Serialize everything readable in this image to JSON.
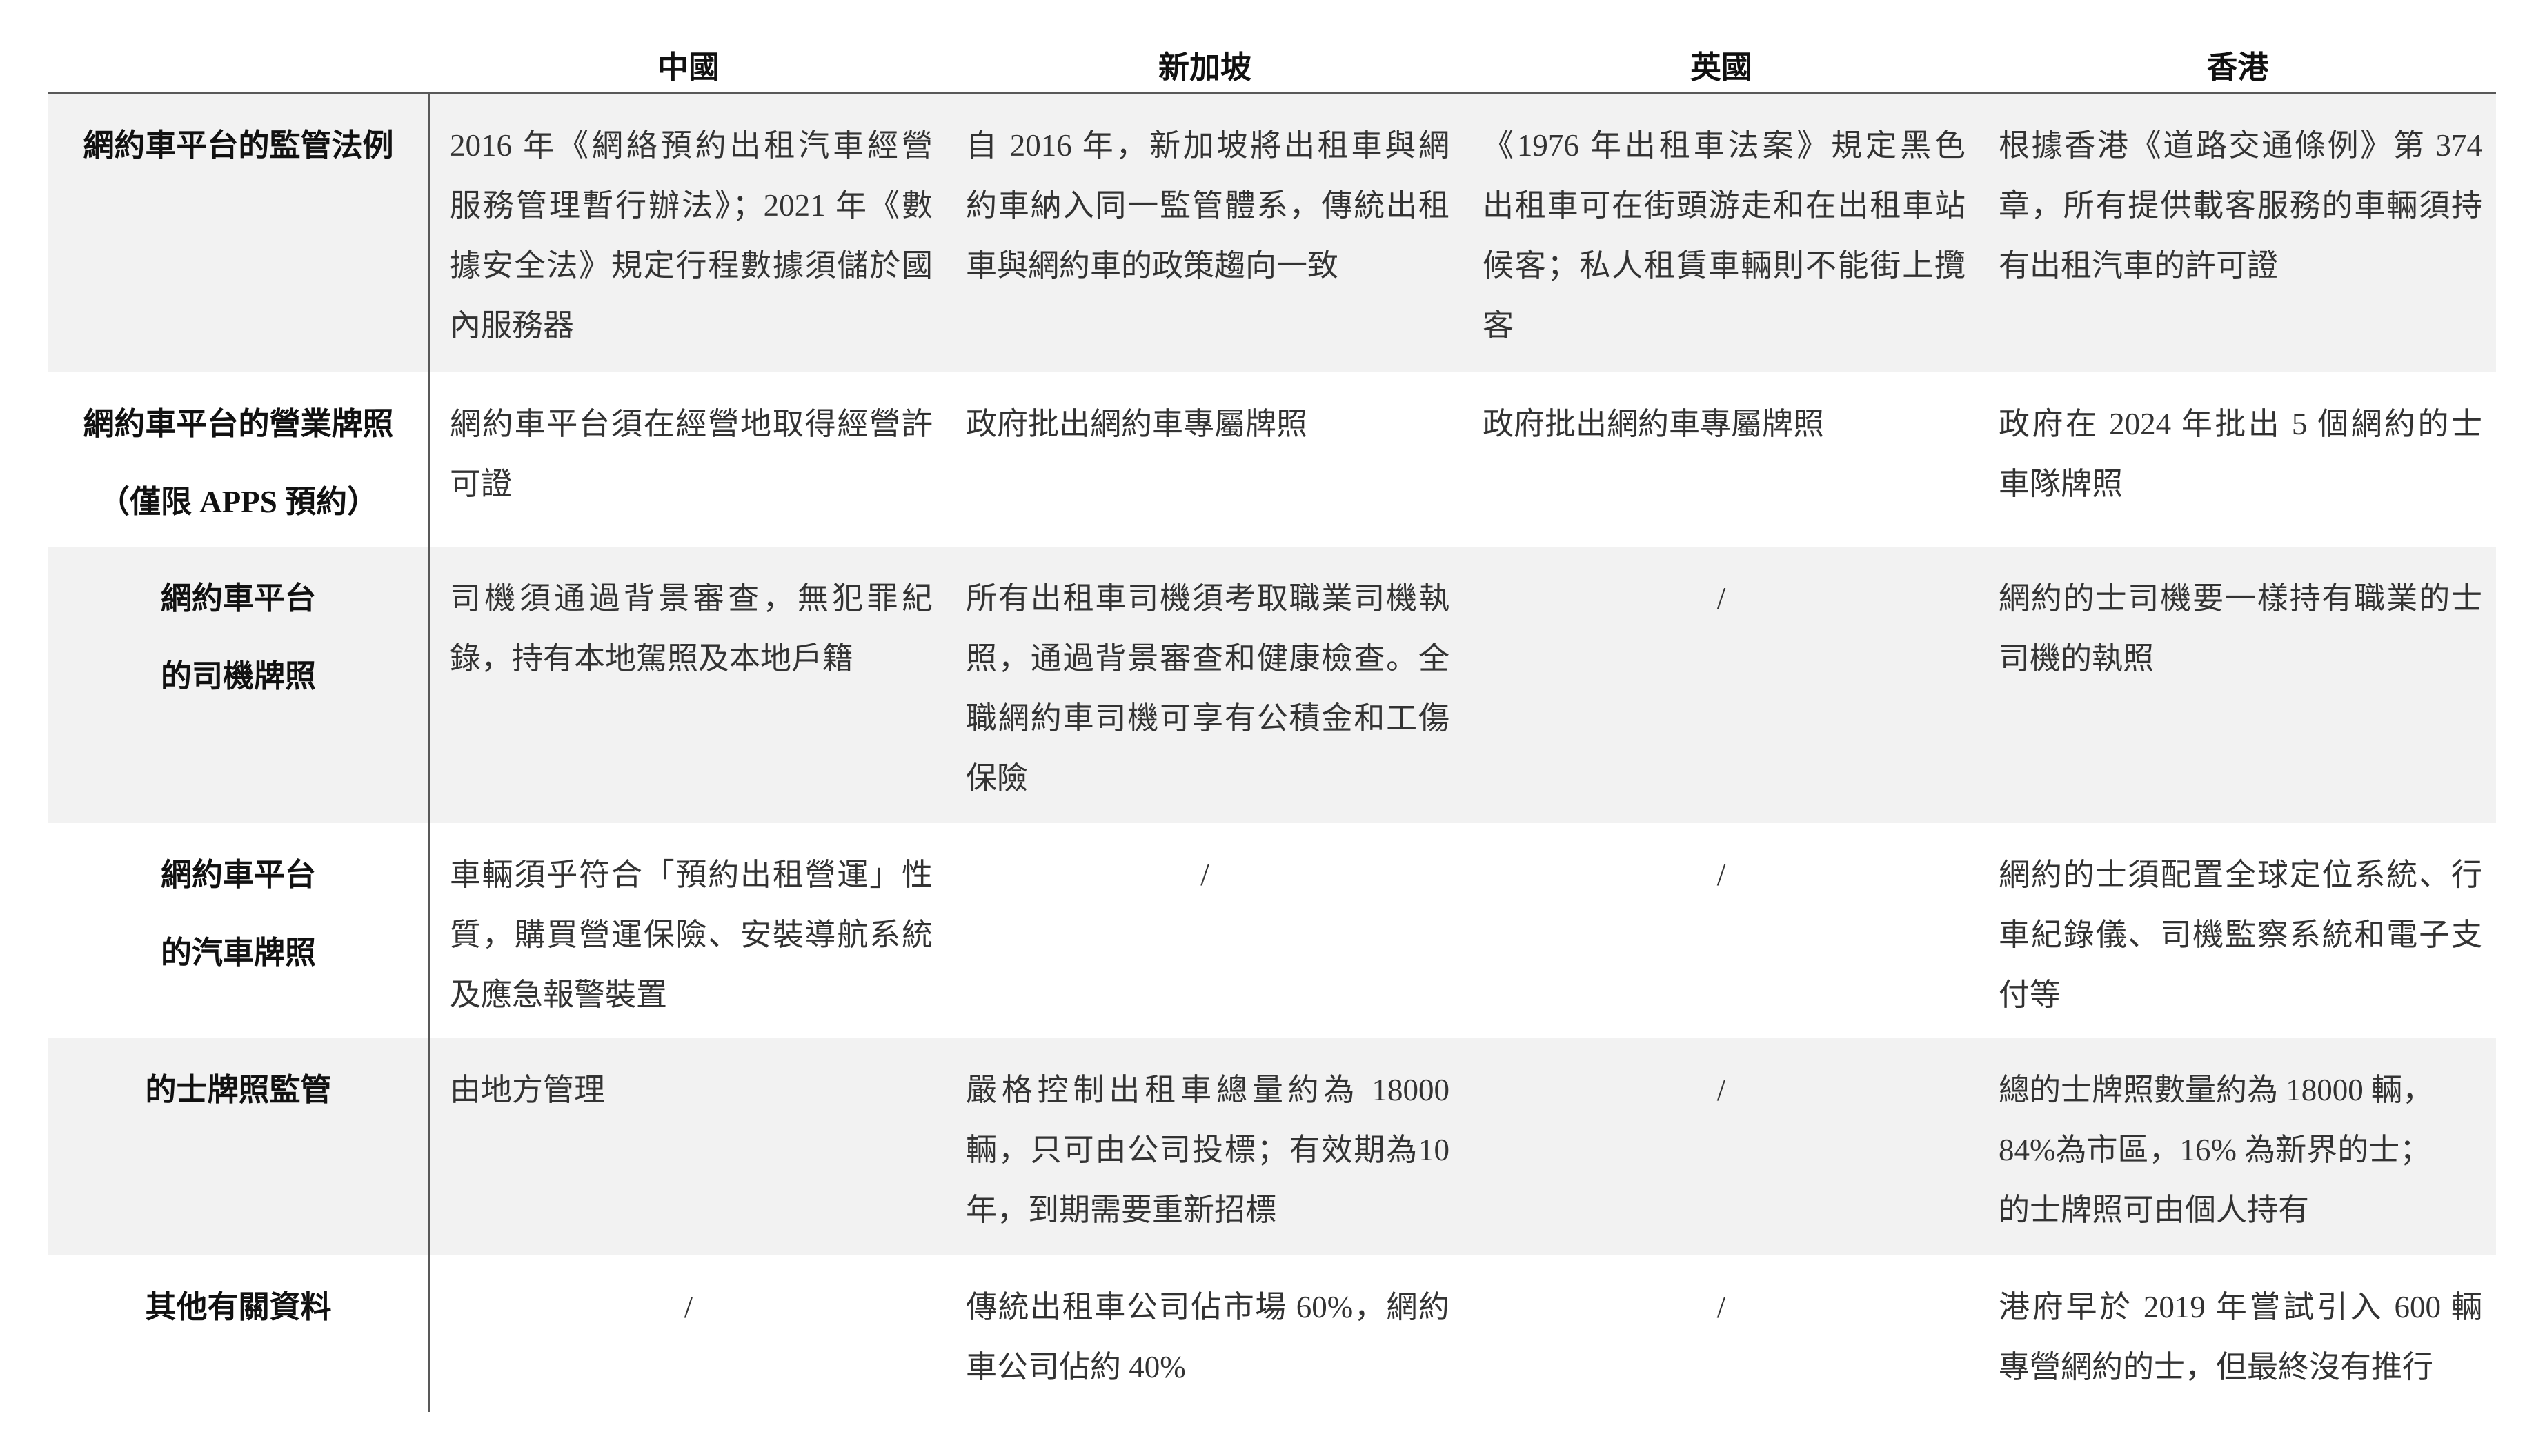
{
  "theme": {
    "stripe_color": "#f2f2f2",
    "rule_color": "#595959",
    "text_color": "#333333",
    "heading_color": "#111111"
  },
  "table": {
    "columns": [
      "中國",
      "新加坡",
      "英國",
      "香港"
    ],
    "rows": [
      {
        "label": [
          "網約車平台的監管法例"
        ],
        "cells": [
          [
            "2016 年《網絡預約出租汽車經營",
            "服務管理暫行辦法》；2021 年《數",
            "據安全法》規定行程數據須儲於國",
            "內服務器"
          ],
          [
            "自 2016 年，新加坡將出租車與網",
            "約車納入同一監管體系，傳統出租",
            "車與網約車的政策趨向一致"
          ],
          [
            "《1976 年出租車法案》規定黑色",
            "出租車可在街頭游走和在出租車站",
            "候客；私人租賃車輛則不能街上攬",
            "客"
          ],
          [
            "根據香港《道路交通條例》第 374",
            "章，所有提供載客服務的車輛須持",
            "有出租汽車的許可證"
          ]
        ]
      },
      {
        "label": [
          "網約車平台的營業牌照",
          "（僅限 APPS 預約）"
        ],
        "cells": [
          [
            "網約車平台須在經營地取得經營許",
            "可證"
          ],
          [
            "政府批出網約車專屬牌照"
          ],
          [
            "政府批出網約車專屬牌照"
          ],
          [
            "政府在 2024 年批出 5 個網約的士",
            "車隊牌照"
          ]
        ]
      },
      {
        "label": [
          "網約車平台",
          "的司機牌照"
        ],
        "cells": [
          [
            "司機須通過背景審查，無犯罪紀",
            "錄，持有本地駕照及本地戶籍"
          ],
          [
            "所有出租車司機須考取職業司機執",
            "照，通過背景審查和健康檢查。全",
            "職網約車司機可享有公積金和工傷",
            "保險"
          ],
          [
            "/"
          ],
          [
            "網約的士司機要一樣持有職業的士",
            "司機的執照"
          ]
        ]
      },
      {
        "label": [
          "網約車平台",
          "的汽車牌照"
        ],
        "cells": [
          [
            "車輛須乎符合「預約出租營運」性",
            "質，購買營運保險、安裝導航系統",
            "及應急報警裝置"
          ],
          [
            "/"
          ],
          [
            "/"
          ],
          [
            "網約的士須配置全球定位系統、行",
            "車紀錄儀、司機監察系統和電子支",
            "付等"
          ]
        ]
      },
      {
        "label": [
          "的士牌照監管"
        ],
        "cells": [
          [
            "由地方管理"
          ],
          [
            "嚴格控制出租車總量約為 18000",
            "輛，只可由公司投標；有效期為10",
            "年，到期需要重新招標"
          ],
          [
            "/"
          ],
          [
            "總的士牌照數量約為 18000 輛，",
            "84%為市區，16% 為新界的士；",
            "的士牌照可由個人持有"
          ]
        ]
      },
      {
        "label": [
          "其他有關資料"
        ],
        "cells": [
          [
            "/"
          ],
          [
            "傳統出租車公司佔市場 60%，網約",
            "車公司佔約 40%"
          ],
          [
            "/"
          ],
          [
            "港府早於 2019 年嘗試引入 600 輛",
            "專營網約的士，但最終沒有推行"
          ]
        ]
      }
    ]
  }
}
